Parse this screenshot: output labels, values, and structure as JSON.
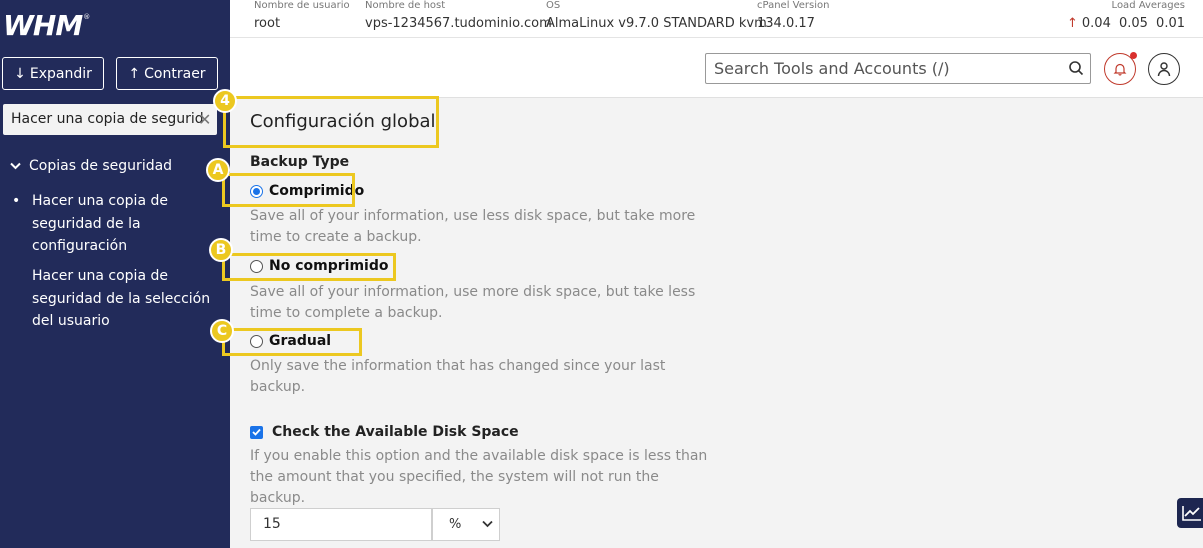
{
  "app": {
    "logo_text": "WHM",
    "logo_mark": "®"
  },
  "sidebar": {
    "expand_label": "Expandir",
    "collapse_label": "Contraer",
    "search_value": "Hacer una copia de segurid",
    "section_label": "Copias de seguridad",
    "items": [
      {
        "label": "Hacer una copia de seguridad de la configuración",
        "active": true
      },
      {
        "label": "Hacer una copia de seguridad de la selección del usuario",
        "active": false
      }
    ]
  },
  "infobar": {
    "username_label": "Nombre de usuario",
    "username_value": "root",
    "hostname_label": "Nombre de host",
    "hostname_value": "vps-1234567.tudominio.com",
    "os_label": "OS",
    "os_value": "AlmaLinux v9.7.0 STANDARD kvm",
    "cpanel_label": "cPanel Version",
    "cpanel_value": "134.0.17",
    "load_label": "Load Averages",
    "load_values": "0.04 0.05 0.01"
  },
  "header": {
    "search_placeholder": "Search Tools and Accounts (/)"
  },
  "main": {
    "title": "Configuración global",
    "backup_type_label": "Backup Type",
    "options": [
      {
        "label": "Comprimido",
        "checked": true,
        "description": "Save all of your information, use less disk space, but take more time to create a backup."
      },
      {
        "label": "No comprimido",
        "checked": false,
        "description": "Save all of your information, use more disk space, but take less time to complete a backup."
      },
      {
        "label": "Gradual",
        "checked": false,
        "description": "Only save the information that has changed since your last backup."
      }
    ],
    "disk_check_label": "Check the Available Disk Space",
    "disk_check_checked": true,
    "disk_check_description": "If you enable this option and the available disk space is less than the amount that you specified, the system will not run the backup.",
    "disk_value": "15",
    "disk_unit": "%"
  },
  "annotations": {
    "title_badge": "4",
    "badge_a": "A",
    "badge_b": "B",
    "badge_c": "C"
  },
  "colors": {
    "sidebar_bg": "#222b5a",
    "highlight": "#ecc820",
    "accent": "#1a73e8",
    "alert": "#d9302e"
  }
}
